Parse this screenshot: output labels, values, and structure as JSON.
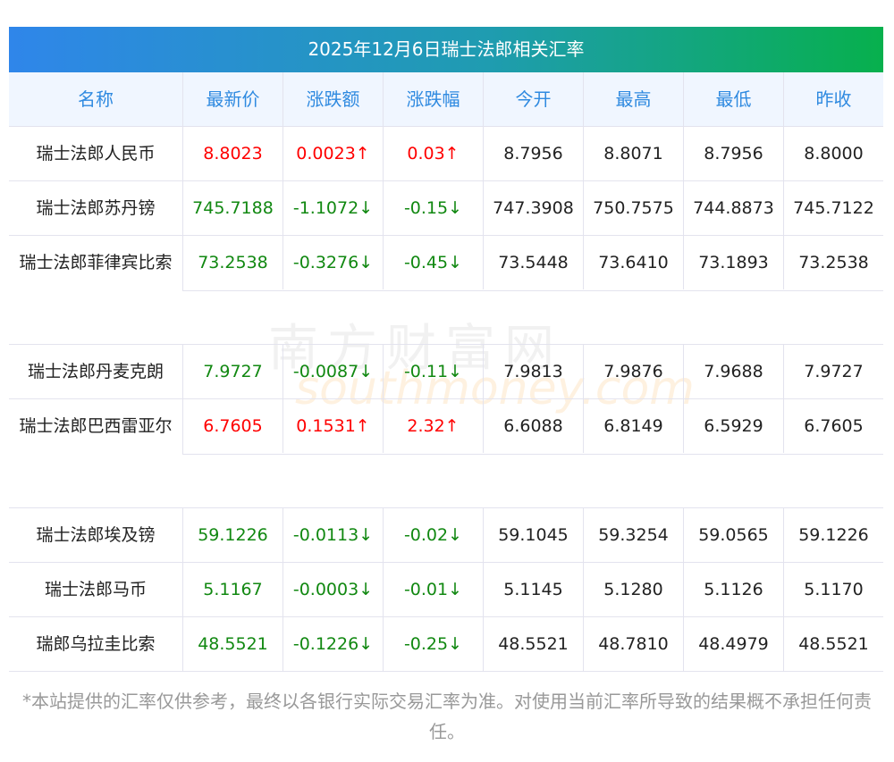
{
  "title": "2025年12月6日瑞士法郎相关汇率",
  "headers": [
    "名称",
    "最新价",
    "涨跌额",
    "涨跌幅",
    "今开",
    "最高",
    "最低",
    "昨收"
  ],
  "rows": [
    {
      "name": "瑞士法郎人民币",
      "dir": "up",
      "latest": "8.8023",
      "chg": "0.0023↑",
      "pct": "0.03↑",
      "open": "8.7956",
      "high": "8.8071",
      "low": "8.7956",
      "prev": "8.8000"
    },
    {
      "name": "瑞士法郎苏丹镑",
      "dir": "down",
      "latest": "745.7188",
      "chg": "-1.1072↓",
      "pct": "-0.15↓",
      "open": "747.3908",
      "high": "750.7575",
      "low": "744.8873",
      "prev": "745.7122"
    },
    {
      "name": "瑞士法郎菲律宾比索",
      "dir": "down",
      "latest": "73.2538",
      "chg": "-0.3276↓",
      "pct": "-0.45↓",
      "open": "73.5448",
      "high": "73.6410",
      "low": "73.1893",
      "prev": "73.2538"
    },
    {
      "name": "瑞士法郎丹麦克朗",
      "dir": "down",
      "latest": "7.9727",
      "chg": "-0.0087↓",
      "pct": "-0.11↓",
      "open": "7.9813",
      "high": "7.9876",
      "low": "7.9688",
      "prev": "7.9727"
    },
    {
      "name": "瑞士法郎巴西雷亚尔",
      "dir": "up",
      "latest": "6.7605",
      "chg": "0.1531↑",
      "pct": "2.32↑",
      "open": "6.6088",
      "high": "6.8149",
      "low": "6.5929",
      "prev": "6.7605"
    },
    {
      "name": "瑞士法郎埃及镑",
      "dir": "down",
      "latest": "59.1226",
      "chg": "-0.0113↓",
      "pct": "-0.02↓",
      "open": "59.1045",
      "high": "59.3254",
      "low": "59.0565",
      "prev": "59.1226"
    },
    {
      "name": "瑞士法郎马币",
      "dir": "down",
      "latest": "5.1167",
      "chg": "-0.0003↓",
      "pct": "-0.01↓",
      "open": "5.1145",
      "high": "5.1280",
      "low": "5.1126",
      "prev": "5.1170"
    },
    {
      "name": "瑞郎乌拉圭比索",
      "dir": "down",
      "latest": "48.5521",
      "chg": "-0.1226↓",
      "pct": "-0.25↓",
      "open": "48.5521",
      "high": "48.7810",
      "low": "48.4979",
      "prev": "48.5521"
    }
  ],
  "watermark": {
    "cn": "南方财富网",
    "en": "southmoney.com"
  },
  "note": "*本站提供的汇率仅供参考，最终以各银行实际交易汇率为准。对使用当前汇率所导致的结果概不承担任何责任。",
  "colors": {
    "up": "#ff0000",
    "down": "#118811",
    "header_text": "#2f8ae0"
  }
}
